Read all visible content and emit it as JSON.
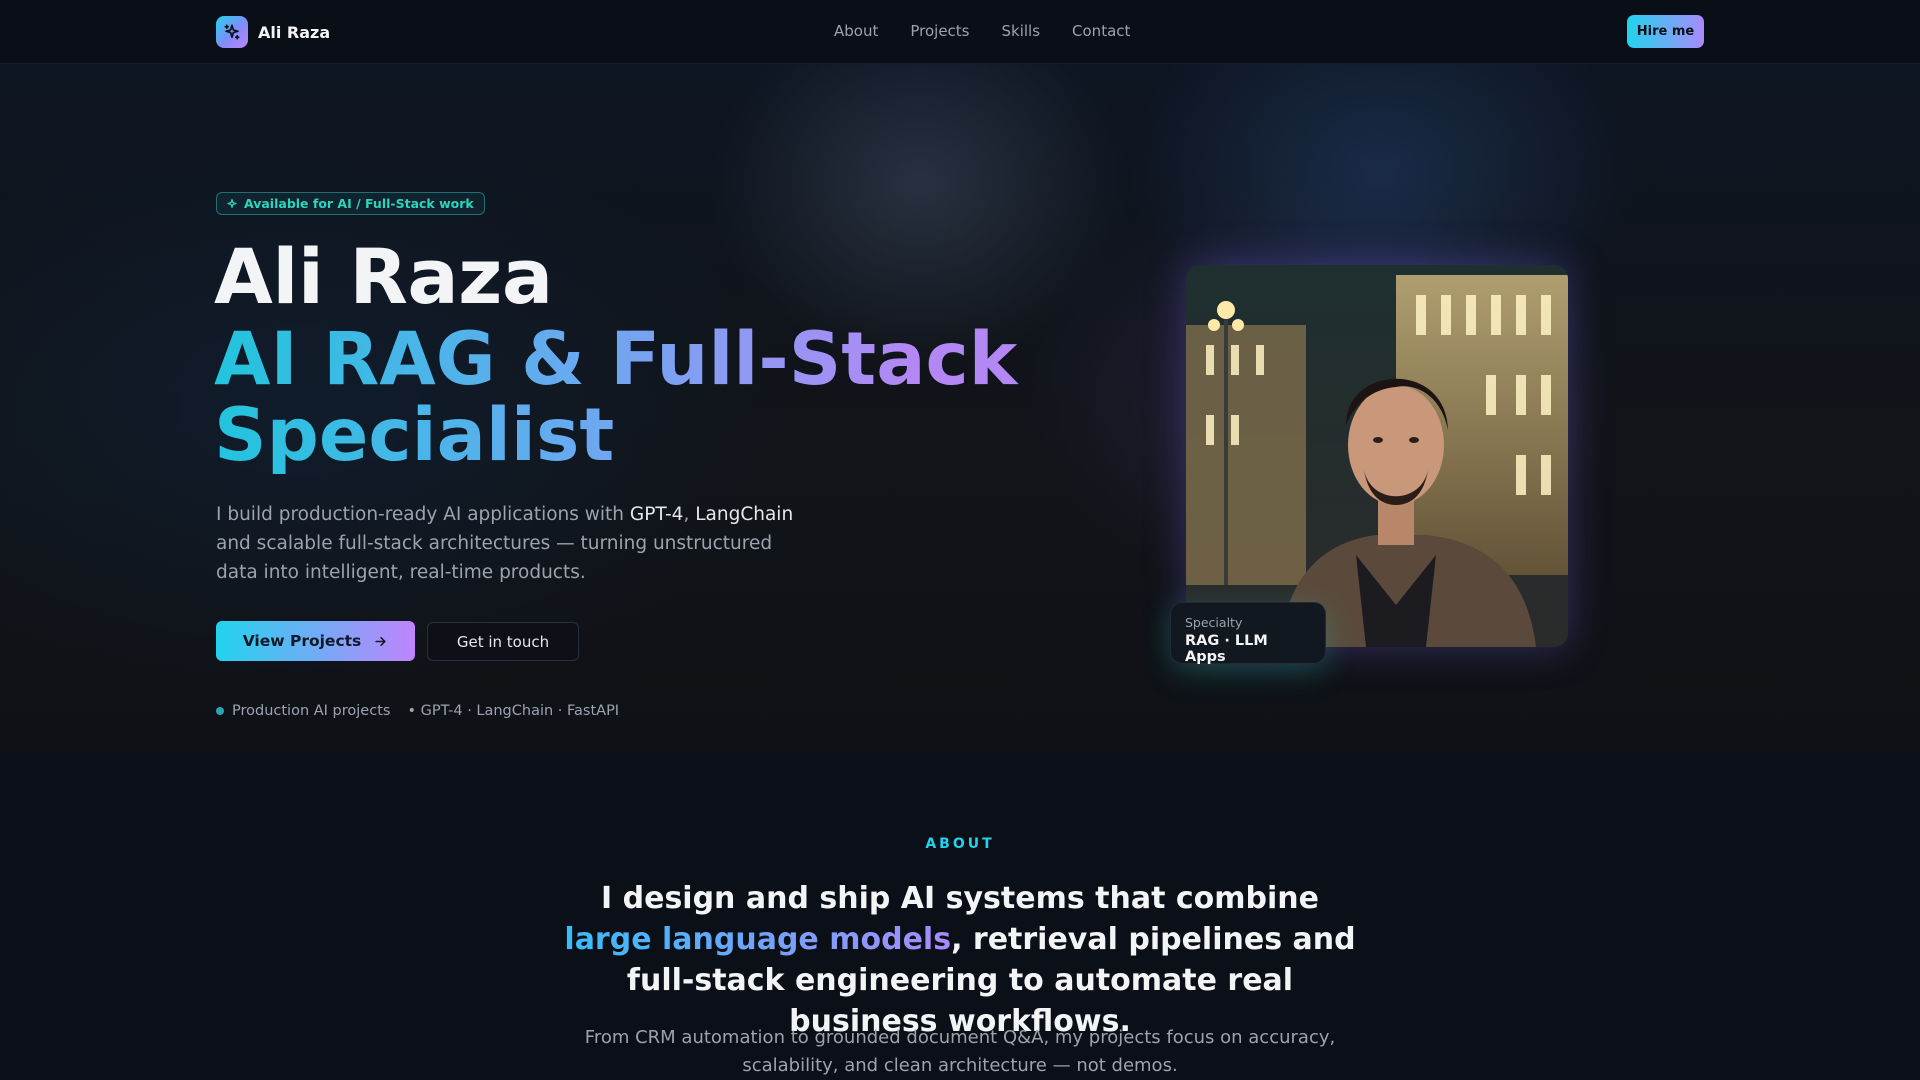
{
  "nav": {
    "brand": "Ali Raza",
    "links": [
      "About",
      "Projects",
      "Skills",
      "Contact"
    ],
    "cta": "Hire me"
  },
  "hero": {
    "badge": "Available for AI / Full-Stack work",
    "name": "Ali Raza",
    "title_line1": "AI RAG & Full-Stack",
    "title_line2": "Specialist",
    "desc_part1": "I build production-ready AI applications with ",
    "desc_hl1": "GPT-4",
    "desc_sep": ", ",
    "desc_hl2": "LangChain",
    "desc_part2": " and scalable full-stack architectures — turning unstructured data into intelligent, real-time products.",
    "btn_primary": "View Projects",
    "btn_secondary": "Get in touch",
    "meta1": "Production AI projects",
    "meta2": "• GPT-4 · LangChain · FastAPI"
  },
  "specialty": {
    "label": "Specialty",
    "value": "RAG · LLM Apps"
  },
  "about": {
    "eyebrow": "ABOUT",
    "head_part1": "I design and ship AI systems that combine ",
    "head_highlight": "large language models",
    "head_part2": ", retrieval pipelines and full-stack engineering to automate real business workflows.",
    "sub": "From CRM automation to grounded document Q&A, my projects focus on accuracy, scalability, and clean architecture — not demos."
  },
  "colors": {
    "accent_cyan": "#22d3ee",
    "accent_purple": "#c084fc",
    "background": "#0b0f17"
  }
}
